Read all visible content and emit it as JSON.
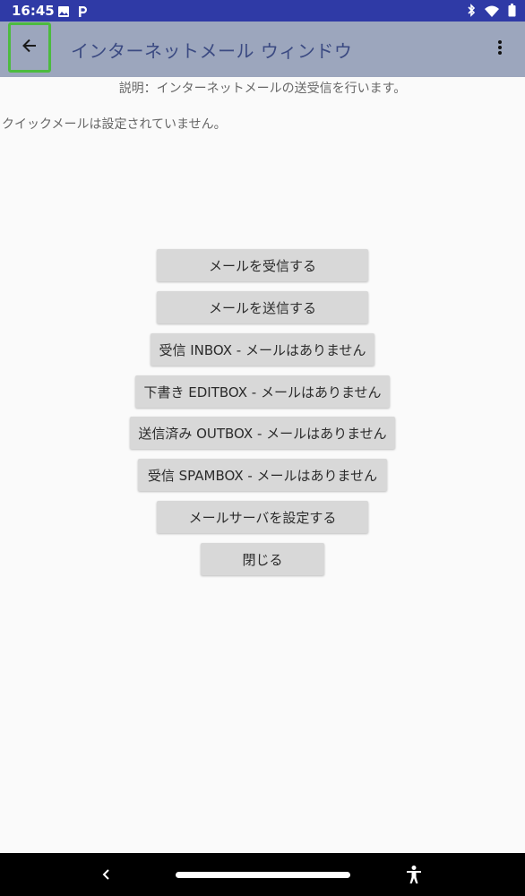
{
  "status_bar": {
    "time": "16:45",
    "left_icons": [
      "image-icon",
      "parking-icon"
    ],
    "right_icons": [
      "bluetooth-icon",
      "wifi-icon",
      "battery-icon"
    ],
    "background": "#2f3aa6"
  },
  "app_bar": {
    "title": "インターネットメール ウィンドウ",
    "back_icon": "arrow-left-icon",
    "menu_icon": "more-vert-icon",
    "background": "#9ca6bd",
    "title_color": "#3b4a82",
    "focus_outline_color": "#4cbb3f"
  },
  "content": {
    "description": "説明：インターネットメールの送受信を行います。",
    "quick_mail_status": "クイックメールは設定されていません。"
  },
  "buttons": {
    "receive": "メールを受信する",
    "send": "メールを送信する",
    "inbox": "受信 INBOX - メールはありません",
    "editbox": "下書き EDITBOX - メールはありません",
    "outbox": "送信済み OUTBOX - メールはありません",
    "spambox": "受信 SPAMBOX - メールはありません",
    "server_settings": "メールサーバを設定する",
    "close": "閉じる"
  },
  "nav_bar": {
    "icons": [
      "nav-back-icon",
      "home-pill-icon",
      "accessibility-icon"
    ]
  }
}
